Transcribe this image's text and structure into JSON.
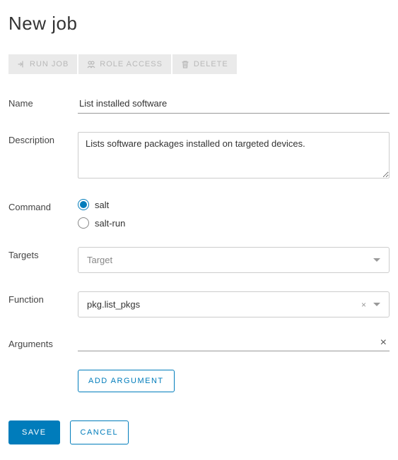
{
  "page": {
    "title": "New job"
  },
  "toolbar": {
    "run_job": "RUN JOB",
    "role_access": "ROLE ACCESS",
    "delete": "DELETE"
  },
  "labels": {
    "name": "Name",
    "description": "Description",
    "command": "Command",
    "targets": "Targets",
    "function": "Function",
    "arguments": "Arguments"
  },
  "fields": {
    "name": "List installed software",
    "description": "Lists software packages installed on targeted devices.",
    "command_options": {
      "salt": "salt",
      "salt_run": "salt-run",
      "selected": "salt"
    },
    "targets_placeholder": "Target",
    "function": "pkg.list_pkgs"
  },
  "buttons": {
    "add_argument": "ADD ARGUMENT",
    "save": "SAVE",
    "cancel": "CANCEL"
  }
}
